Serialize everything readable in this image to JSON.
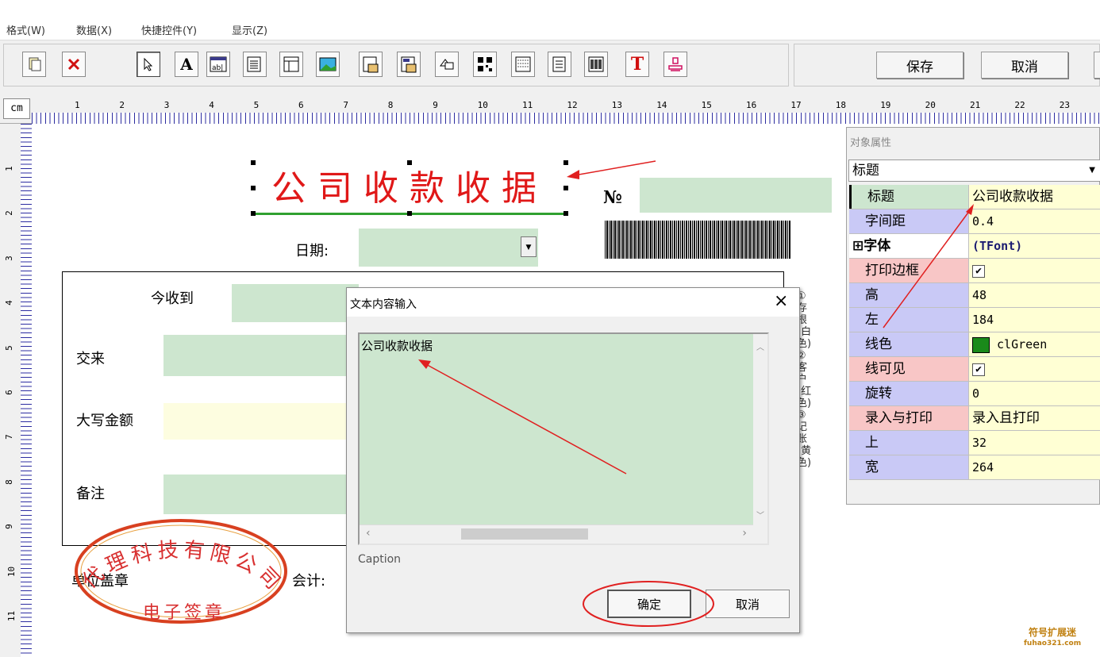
{
  "menu": [
    "格式(W)",
    "数据(X)",
    "快捷控件(Y)",
    "显示(Z)"
  ],
  "toolbar": {
    "save_label": "保存",
    "cancel_label": "取消",
    "tools": [
      "new-page-icon",
      "delete-icon",
      "pointer-icon",
      "text-icon",
      "input-box-icon",
      "memo-icon",
      "table-icon",
      "image-icon",
      "grid-icon",
      "grid-edit-icon",
      "shape-icon",
      "qrcode-icon",
      "list-icon",
      "doc-icon",
      "barcode-icon",
      "title-text-icon",
      "stamp-icon"
    ]
  },
  "ruler": {
    "unit": "cm",
    "top_numbers": [
      "1",
      "2",
      "3",
      "4",
      "5",
      "6",
      "7",
      "8",
      "9",
      "10",
      "11",
      "12",
      "13",
      "14",
      "15",
      "16",
      "17",
      "18",
      "19",
      "20",
      "21",
      "22",
      "23"
    ],
    "left_numbers": [
      "1",
      "2",
      "3",
      "4",
      "5",
      "6",
      "7",
      "8",
      "9",
      "10",
      "11"
    ]
  },
  "form": {
    "title": "公司收款收据",
    "no_label": "№",
    "date_label": "日期:",
    "received_label": "今收到",
    "from_label": "交来",
    "amount_label": "大写金额",
    "remark_label": "备注",
    "seal_label": "单位盖章",
    "accountant_label": "会计:",
    "side_note": "①存根(白色)②客户(红色)③记账(黄色)",
    "stamp_top": "代理科技有限公司",
    "stamp_bottom": "电子签章"
  },
  "dialog": {
    "title": "文本内容输入",
    "close": "×",
    "content": "公司收款收据",
    "field_label": "Caption",
    "ok_label": "确定",
    "cancel_label": "取消"
  },
  "props": {
    "panel_title": "对象属性",
    "selected_object": "标题",
    "rows": [
      {
        "name": "标题",
        "value": "公司收款收据"
      },
      {
        "name": "字间距",
        "value": "0.4"
      },
      {
        "name": "⊞字体",
        "value": "(TFont)"
      },
      {
        "name": "打印边框",
        "value": "checked"
      },
      {
        "name": "高",
        "value": "48"
      },
      {
        "name": "左",
        "value": "184"
      },
      {
        "name": "线色",
        "value": "clGreen"
      },
      {
        "name": "线可见",
        "value": "checked"
      },
      {
        "name": "旋转",
        "value": "0"
      },
      {
        "name": "录入与打印",
        "value": "录入且打印"
      },
      {
        "name": "上",
        "value": "32"
      },
      {
        "name": "宽",
        "value": "264"
      }
    ]
  },
  "watermark": {
    "line1": "符号扩展迷",
    "line2": "fuhao321.com"
  },
  "colors": {
    "title_red": "#e01818",
    "field_green": "#cde6cf",
    "annotation_red": "#e02020",
    "stamp": "#d84020"
  }
}
